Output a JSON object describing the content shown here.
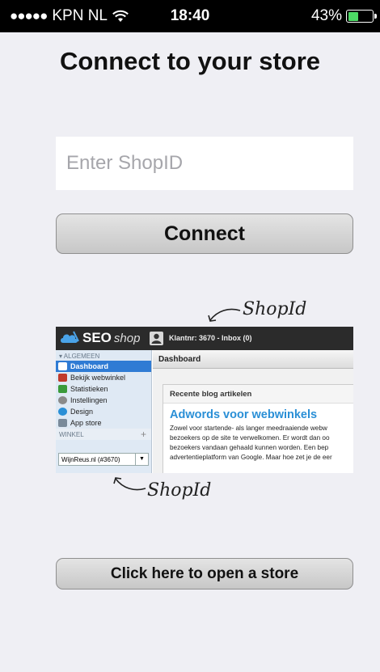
{
  "status_bar": {
    "signal_dots": "●●●●●",
    "carrier": "KPN NL",
    "wifi_icon": "wifi-icon",
    "time": "18:40",
    "battery_percent": "43%",
    "battery_level": 0.43
  },
  "header": {
    "title": "Connect to your store"
  },
  "shop_input": {
    "placeholder": "Enter ShopID",
    "value": ""
  },
  "connect_button": {
    "label": "Connect"
  },
  "annotation": {
    "label": "ShopId"
  },
  "preview": {
    "logo_seo": "SEO",
    "logo_shop": "shop",
    "top_bar_text": "Klantnr: 3670 - Inbox (0)",
    "sidebar_section": "▾ ALGEMEEN",
    "sidebar_items": [
      {
        "label": "Dashboard",
        "active": true,
        "color": "#ffffff"
      },
      {
        "label": "Bekijk webwinkel",
        "color": "#c0392b"
      },
      {
        "label": "Statistieken",
        "color": "#3a9a3a"
      },
      {
        "label": "Instellingen",
        "color": "#8a8a8a"
      },
      {
        "label": "Design",
        "color": "#2a8fd6"
      },
      {
        "label": "App store",
        "color": "#7a8a9a"
      }
    ],
    "winkel_label": "WINKEL",
    "winkel_plus": "+",
    "store_select": "WijnReus.nl (#3670)",
    "select_arrow": "▼",
    "dashboard_label": "Dashboard",
    "card_header": "Recente blog artikelen",
    "card_title": "Adwords voor webwinkels",
    "card_lines": [
      "Zowel voor startende- als langer meedraaiende webw",
      "bezoekers op de site te verwelkomen. Er wordt dan oo",
      "bezoekers vandaan gehaald kunnen worden. Een bep",
      "advertentieplatform van Google. Maar hoe zet je de eer"
    ]
  },
  "open_store_button": {
    "label": "Click here to open a store"
  }
}
